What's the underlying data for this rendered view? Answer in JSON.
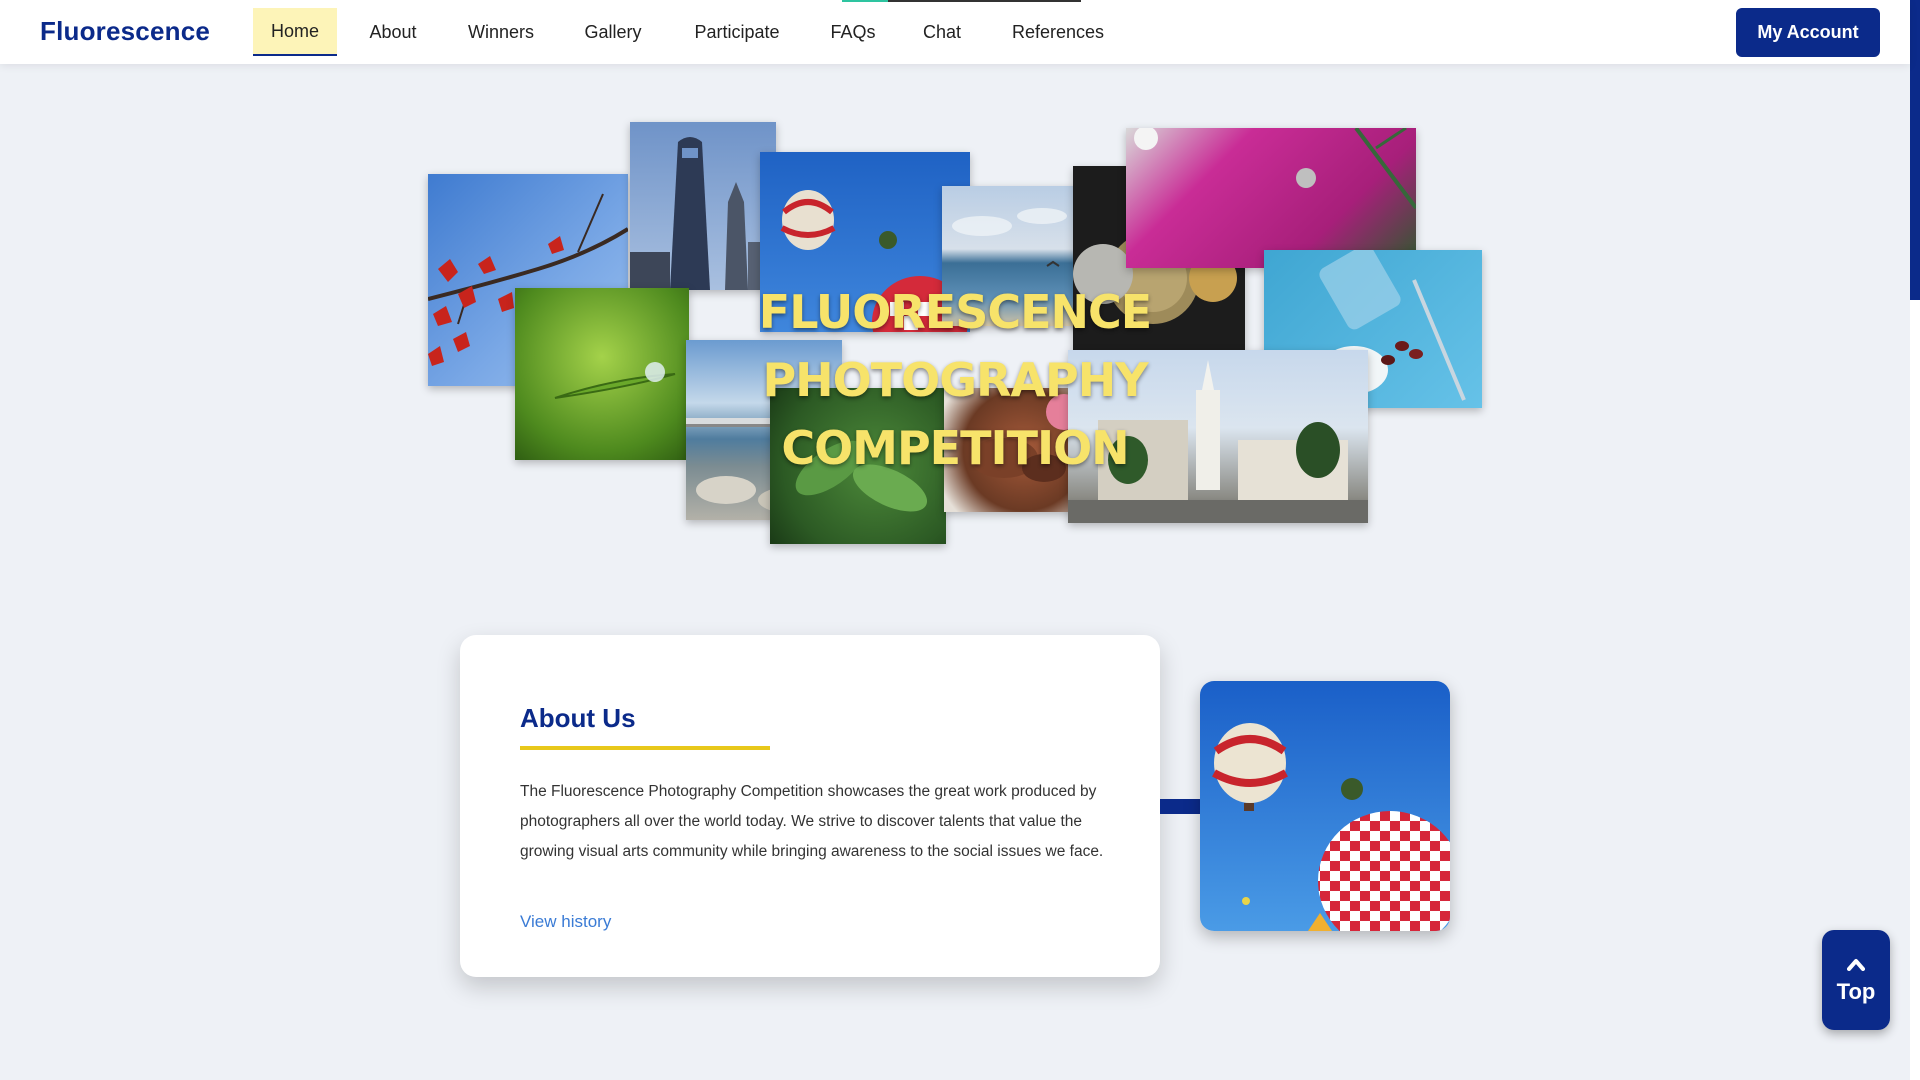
{
  "brand": "Fluorescence",
  "nav": [
    {
      "label": "Home",
      "active": true
    },
    {
      "label": "About",
      "active": false
    },
    {
      "label": "Winners",
      "active": false
    },
    {
      "label": "Gallery",
      "active": false
    },
    {
      "label": "Participate",
      "active": false
    },
    {
      "label": "FAQs",
      "active": false
    },
    {
      "label": "Chat",
      "active": false
    },
    {
      "label": "References",
      "active": false
    }
  ],
  "account_label": "My Account",
  "hero": {
    "title_line1": "FLUORESCENCE PHOTOGRAPHY",
    "title_line2": "COMPETITION"
  },
  "about": {
    "title": "About Us",
    "body": "The Fluorescence Photography Competition showcases the great work produced by photographers all over the world today. We strive to discover talents that value the growing visual arts community while bringing awareness to the social issues we face.",
    "link": "View history"
  },
  "top_button": {
    "icon": "chevron-up-icon",
    "label": "Top"
  },
  "colors": {
    "brand_blue": "#0b2a8a",
    "accent_yellow": "#e8c81a",
    "title_yellow": "#f7e36a",
    "nav_active_bg": "#fdf4b8",
    "link_blue": "#3a7bd5",
    "page_bg": "#eef1f6"
  }
}
